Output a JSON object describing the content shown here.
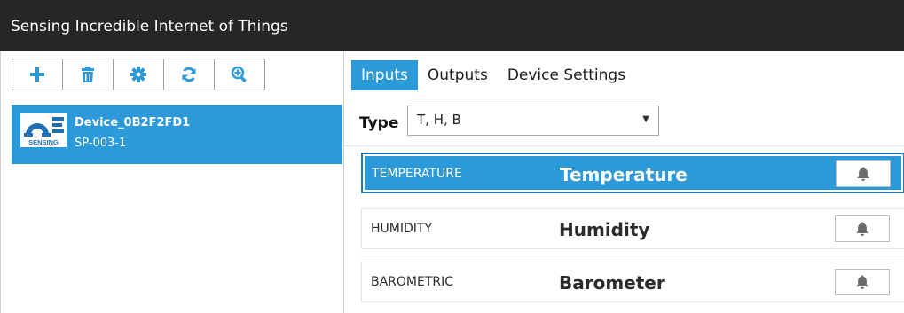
{
  "window": {
    "title": "Sensing Incredible Internet of Things"
  },
  "toolbar": {
    "buttons": [
      {
        "icon": "plus-icon"
      },
      {
        "icon": "trash-icon"
      },
      {
        "icon": "gear-icon"
      },
      {
        "icon": "refresh-icon"
      },
      {
        "icon": "zoom-in-icon"
      }
    ]
  },
  "devices": [
    {
      "name": "Device_0B2F2FD1",
      "model": "SP-003-1",
      "logo_text": "SENSING",
      "selected": true
    }
  ],
  "tabs": {
    "inputs": "Inputs",
    "outputs": "Outputs",
    "device_settings": "Device Settings",
    "active": "Inputs"
  },
  "type_filter": {
    "label": "Type",
    "value": "T, H, B"
  },
  "sensors": [
    {
      "code": "TEMPERATURE",
      "name": "Temperature",
      "selected": true
    },
    {
      "code": "HUMIDITY",
      "name": "Humidity",
      "selected": false
    },
    {
      "code": "BAROMETRIC",
      "name": "Barometer",
      "selected": false
    }
  ],
  "colors": {
    "accent": "#2c9ad8",
    "titlebar": "#262626",
    "icon": "#2c9ad8"
  }
}
